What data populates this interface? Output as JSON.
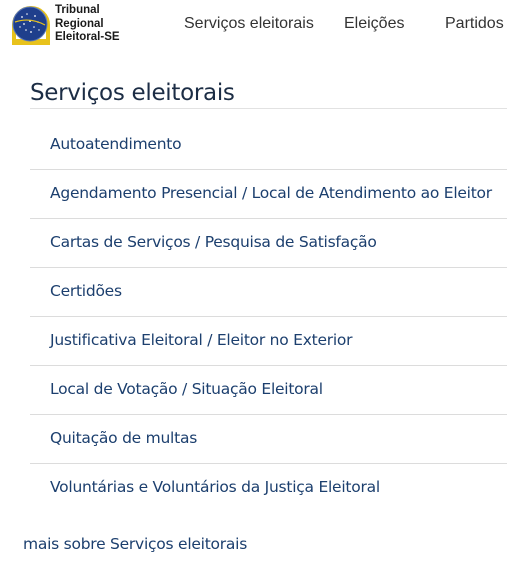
{
  "header": {
    "logo": {
      "line1": "Tribunal",
      "line2": "Regional",
      "line3": "Eleitoral-SE"
    },
    "nav": [
      {
        "label": "Serviços eleitorais"
      },
      {
        "label": "Eleições"
      },
      {
        "label": "Partidos"
      }
    ]
  },
  "main": {
    "title": "Serviços eleitorais",
    "items": [
      {
        "label": "Autoatendimento"
      },
      {
        "label": "Agendamento Presencial / Local de Atendimento ao Eleitor"
      },
      {
        "label": "Cartas de Serviços / Pesquisa de Satisfação"
      },
      {
        "label": "Certidões"
      },
      {
        "label": "Justificativa Eleitoral / Eleitor no Exterior"
      },
      {
        "label": "Local de Votação / Situação Eleitoral"
      },
      {
        "label": "Quitação de multas"
      },
      {
        "label": "Voluntárias e Voluntários da Justiça Eleitoral"
      }
    ],
    "more_link": "mais sobre Serviços eleitorais"
  },
  "colors": {
    "link": "#1c3f6e",
    "title": "#1c2d45",
    "emblem_blue": "#1f3f8c",
    "emblem_gold": "#e8c21c",
    "divider": "#dcdcdc"
  },
  "icons": {
    "logo_emblem": "tre-se-emblem"
  }
}
